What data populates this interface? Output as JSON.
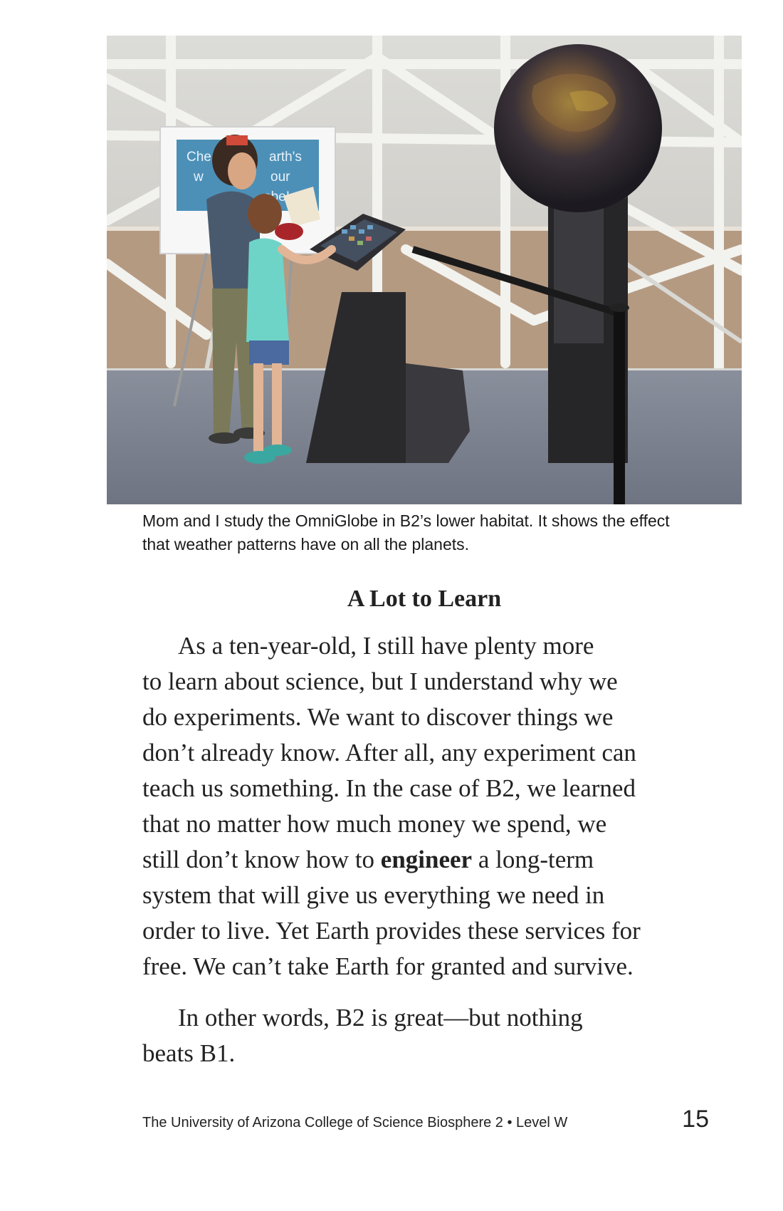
{
  "photo": {
    "sign_lines": [
      "Che",
      "arth's",
      "w",
      "our",
      "obe!"
    ]
  },
  "caption": {
    "line1": "Mom and I study the OmniGlobe in B2’s lower habitat. It shows the effect",
    "line2": "that weather patterns have on all the planets."
  },
  "heading": "A Lot to Learn",
  "paragraph1": {
    "line1": "As a ten-year-old, I still have plenty more",
    "line2": "to learn about science, but I understand why we",
    "line3": "do experiments. We want to discover things we",
    "line4": "don’t already know. After all, any experiment can",
    "line5": "teach us something. In the case of B2, we learned",
    "line6": "that no matter how much money we spend, we",
    "line7_before": "still don’t know how to ",
    "line7_bold": "engineer",
    "line7_after": " a long-term",
    "line8": "system that will give us everything we need in",
    "line9": "order to live. Yet Earth provides these services for",
    "line10": "free. We can’t take Earth for granted and survive."
  },
  "paragraph2": {
    "line1": "In other words, B2 is great—but nothing",
    "line2": "beats B1."
  },
  "footer": {
    "credit": "The University of Arizona College of Science Biosphere 2 • Level W",
    "page_number": "15"
  }
}
